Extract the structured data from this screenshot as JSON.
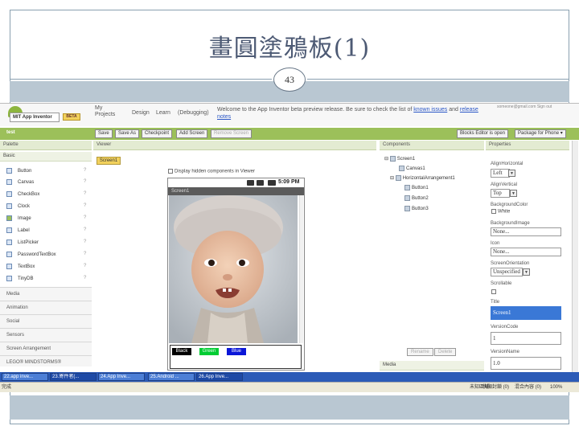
{
  "slide": {
    "title": "畫圓塗鴉板(1)",
    "page_number": "43"
  },
  "app_header": {
    "logo_text": "MIT App Inventor",
    "beta_badge": "BETA",
    "nav_my": "My",
    "nav_projects": "Projects",
    "nav_design": "Design",
    "nav_learn": "Learn",
    "nav_debugging": "(Debugging)",
    "welcome_text": "Welcome to the App Inventor beta preview release. Be sure to check the list of",
    "known_issues_link": "known issues",
    "welcome_and": "and",
    "release_notes_link": "release notes",
    "user_line": "someone@gmail.com  Sign out"
  },
  "toolbar": {
    "project_name": "test",
    "buttons": [
      "Save",
      "Save As",
      "Checkpoint",
      "Add Screen",
      "Remove Screen"
    ],
    "blocks_editor": "Blocks Editor is open",
    "package": "Package for Phone ▾"
  },
  "palette": {
    "header": "Palette",
    "basic": "Basic",
    "items": [
      "Button",
      "Canvas",
      "CheckBox",
      "Clock",
      "Image",
      "Label",
      "ListPicker",
      "PasswordTextBox",
      "TextBox",
      "TinyDB"
    ],
    "help": "?",
    "categories": [
      "Media",
      "Animation",
      "Social",
      "Sensors",
      "Screen Arrangement",
      "LEGO® MINDSTORMS®"
    ]
  },
  "viewer": {
    "header": "Viewer",
    "screen_tab": "Screen1",
    "hidden_label": "Display hidden components in Viewer",
    "clock": "5:09 PM",
    "screen_title": "Screen1",
    "buttons": [
      {
        "label": "Black",
        "color": "#000000"
      },
      {
        "label": "Green",
        "color": "#00cc33"
      },
      {
        "label": "Blue",
        "color": "#0b16d8"
      }
    ]
  },
  "components": {
    "header": "Components",
    "tree": [
      "Screen1",
      "Canvas1",
      "HorizontalArrangement1",
      "Button1",
      "Button2",
      "Button3"
    ],
    "rename": "Rename",
    "delete": "Delete",
    "media": "Media"
  },
  "properties": {
    "header": "Properties",
    "align_horizontal_label": "AlignHorizontal",
    "align_horizontal": "Left",
    "align_vertical_label": "AlignVertical",
    "align_vertical": "Top",
    "background_color_label": "BackgroundColor",
    "background_color": "White",
    "background_image_label": "BackgroundImage",
    "background_image": "None...",
    "icon_label": "Icon",
    "icon": "None...",
    "orientation_label": "ScreenOrientation",
    "orientation": "Unspecified",
    "scrollable_label": "Scrollable",
    "title_label": "Title",
    "title": "Screen1",
    "version_code_label": "VersionCode",
    "version_code": "1",
    "version_name_label": "VersionName",
    "version_name": "1.0"
  },
  "taskbar": {
    "tasks": [
      "22.app inve...",
      "23.寄件者(...",
      "24.App Inve...",
      "25.Android ...",
      "26.App Inve..."
    ]
  },
  "statusbar": {
    "left": "完成",
    "zone": "未知區域",
    "popup": "快顯封鎖 (0)",
    "mixed": "混合內容 (0)",
    "zoom": "100%"
  },
  "colors": {
    "toolbar_green": "#9cc05a",
    "panel_header": "#e3ebd2",
    "taskbar_blue": "#2c5bb7",
    "screen_tab": "#f2d15c"
  }
}
